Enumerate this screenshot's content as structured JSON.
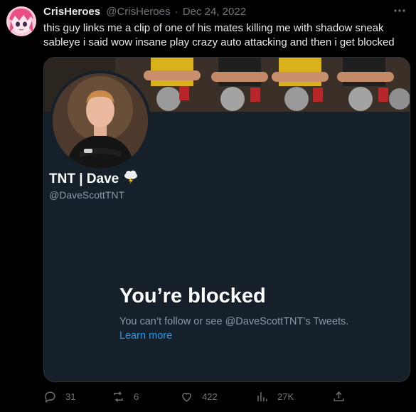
{
  "tweet": {
    "author_name": "CrisHeroes",
    "author_handle": "@CrisHeroes",
    "separator": "·",
    "date": "Dec 24, 2022",
    "text": "this guy links me a clip of one of his mates killing me with shadow sneak sableye i said wow insane play crazy auto attacking and then i get blocked",
    "more_icon": "more-icon"
  },
  "card": {
    "profile_name": "TNT | Dave",
    "profile_emoji_icon": "storm-cloud-icon",
    "profile_handle": "@DaveScottTNT",
    "blocked_title": "You’re blocked",
    "blocked_text": "You can’t follow or see @DaveScottTNT’s Tweets.",
    "learn_more": "Learn more"
  },
  "actions": {
    "replies": "31",
    "retweets": "6",
    "likes": "422",
    "views": "27K"
  },
  "colors": {
    "background": "#000000",
    "card_bg": "#15202b",
    "link": "#1d9bf0",
    "muted": "#71767b"
  }
}
